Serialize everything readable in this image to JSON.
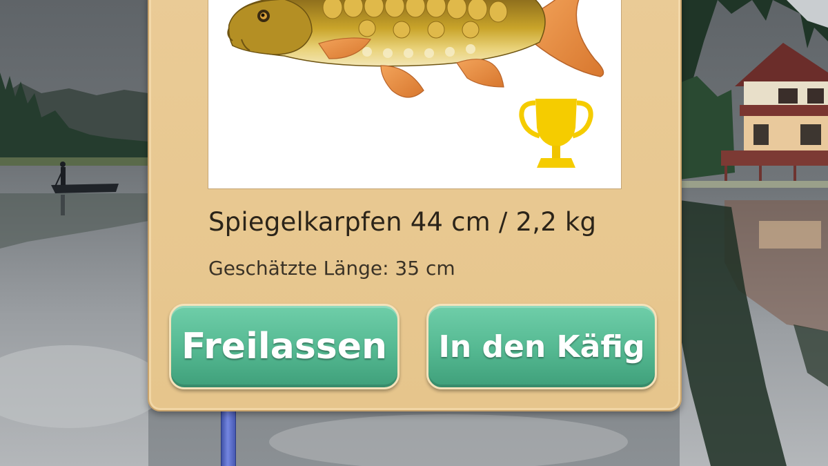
{
  "catch": {
    "title": "Spiegelkarpfen 44 cm / 2,2 kg",
    "estimate": "Geschätzte Länge: 35 cm",
    "species_image": "mirror-carp-illustration",
    "trophy_icon": "trophy-icon"
  },
  "actions": {
    "release_label": "Freilassen",
    "keep_label": "In den Käfig"
  },
  "colors": {
    "panel": "#e8c891",
    "button": "#56ba93",
    "trophy": "#f2c600",
    "rod": "#5566c8"
  }
}
